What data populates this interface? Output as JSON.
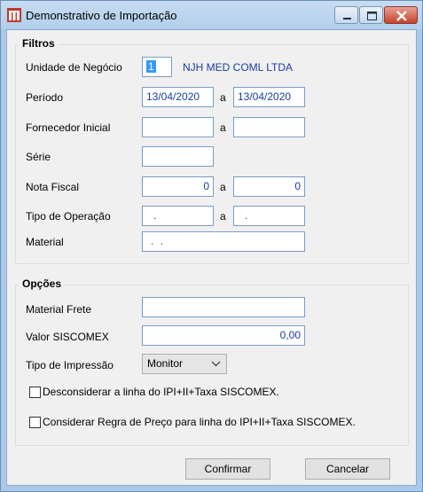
{
  "window": {
    "title": "Demonstrativo de Importação",
    "accent": "#c0392b"
  },
  "filtros": {
    "title": "Filtros",
    "unidade_label": "Unidade de Negócio",
    "unidade_value": "1",
    "unidade_name": "NJH MED COML LTDA",
    "periodo_label": "Período",
    "periodo_from": "13/04/2020",
    "periodo_sep": "a",
    "periodo_to": "13/04/2020",
    "fornecedor_label": "Fornecedor Inicial",
    "fornecedor_from": "",
    "fornecedor_sep": "a",
    "fornecedor_to": "",
    "serie_label": "Série",
    "serie_value": "",
    "nota_label": "Nota Fiscal",
    "nota_from": "0",
    "nota_sep": "a",
    "nota_to": "0",
    "tipo_op_label": "Tipo de Operação",
    "tipo_op_from": ".",
    "tipo_op_sep": "a",
    "tipo_op_to": ".",
    "material_label": "Material",
    "material_value": ". ."
  },
  "opcoes": {
    "title": "Opções",
    "frete_label": "Material Frete",
    "frete_value": "",
    "siscomex_label": "Valor SISCOMEX",
    "siscomex_value": "0,00",
    "impressao_label": "Tipo de Impressão",
    "impressao_value": "Monitor",
    "check1_label": "Desconsiderar a linha do IPI+II+Taxa SISCOMEX.",
    "check2_label": "Considerar Regra de Preço para linha do IPI+II+Taxa SISCOMEX."
  },
  "buttons": {
    "confirm": "Confirmar",
    "cancel": "Cancelar"
  }
}
